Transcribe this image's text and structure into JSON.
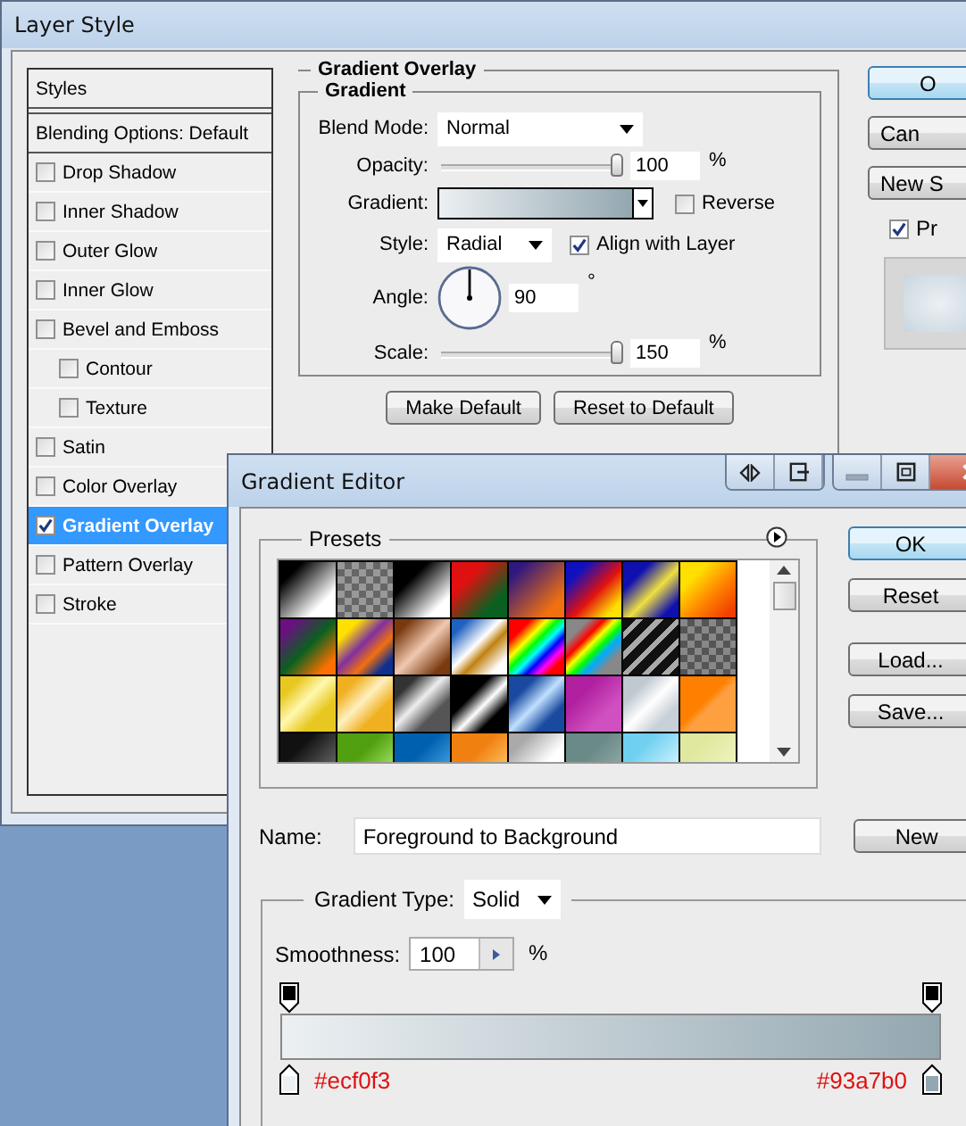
{
  "layer_style": {
    "title": "Layer Style",
    "styles_header": "Styles",
    "blending_options": "Blending Options: Default",
    "styles": [
      {
        "label": "Drop Shadow",
        "checked": false,
        "selected": false
      },
      {
        "label": "Inner Shadow",
        "checked": false,
        "selected": false
      },
      {
        "label": "Outer Glow",
        "checked": false,
        "selected": false
      },
      {
        "label": "Inner Glow",
        "checked": false,
        "selected": false
      },
      {
        "label": "Bevel and Emboss",
        "checked": false,
        "selected": false,
        "children": [
          {
            "label": "Contour",
            "checked": false,
            "selected": false
          },
          {
            "label": "Texture",
            "checked": false,
            "selected": false
          }
        ]
      },
      {
        "label": "Satin",
        "checked": false,
        "selected": false
      },
      {
        "label": "Color Overlay",
        "checked": false,
        "selected": false
      },
      {
        "label": "Gradient Overlay",
        "checked": true,
        "selected": true
      },
      {
        "label": "Pattern Overlay",
        "checked": false,
        "selected": false
      },
      {
        "label": "Stroke",
        "checked": false,
        "selected": false
      }
    ],
    "section_title": "Gradient Overlay",
    "group_title": "Gradient",
    "blend_mode": {
      "label": "Blend Mode:",
      "value": "Normal"
    },
    "opacity": {
      "label": "Opacity:",
      "level": 1,
      "value": "100",
      "unit": "%"
    },
    "gradient": {
      "label": "Gradient:"
    },
    "reverse": {
      "label": "Reverse",
      "checked": false
    },
    "style": {
      "label": "Style:",
      "value": "Radial"
    },
    "align": {
      "label": "Align with Layer",
      "checked": true
    },
    "angle": {
      "label": "Angle:",
      "value": "90",
      "unit": "°"
    },
    "scale": {
      "label": "Scale:",
      "level": 1,
      "value": "150",
      "unit": "%"
    },
    "bottom_buttons": [
      "Make Default",
      "Reset to Default"
    ],
    "side_buttons": [
      "O",
      "Can",
      "New S"
    ],
    "preview": {
      "label": "Pr",
      "checked": true
    }
  },
  "gradient_editor": {
    "title": "Gradient Editor",
    "presets_title": "Presets",
    "buttons": [
      "OK",
      "Reset",
      "Load...",
      "Save..."
    ],
    "name": {
      "label": "Name:",
      "value": "Foreground to Background"
    },
    "new_button": "New",
    "gradient_type": {
      "label": "Gradient Type:",
      "value": "Solid"
    },
    "smoothness": {
      "label": "Smoothness:",
      "value": "100",
      "unit": "%"
    },
    "color_stops": [
      {
        "label": "#ecf0f3",
        "color": "#ecf0f3"
      },
      {
        "label": "#93a7b0",
        "color": "#93a7b0"
      }
    ]
  }
}
